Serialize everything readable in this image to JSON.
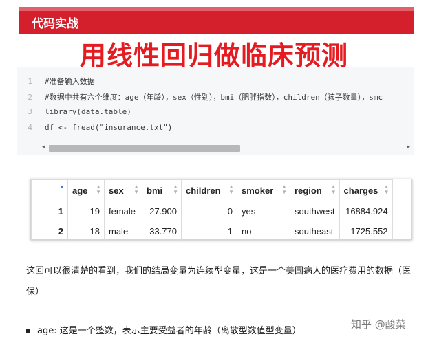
{
  "banner": {
    "title": "代码实战"
  },
  "headline": "用线性回归做临床预测",
  "code": {
    "lines": [
      {
        "num": "1",
        "text": "#准备输入数据"
      },
      {
        "num": "2",
        "text": "#数据中共有六个维度：age（年龄），sex（性别），bmi（肥胖指数），children（孩子数量），smc"
      },
      {
        "num": "3",
        "text": "library(data.table)"
      },
      {
        "num": "4",
        "text": "df <- fread(\"insurance.txt\")"
      }
    ],
    "scroll_left": "◂",
    "scroll_right": "▸"
  },
  "table": {
    "columns": [
      "",
      "age",
      "sex",
      "bmi",
      "children",
      "smoker",
      "region",
      "charges"
    ],
    "rows": [
      [
        "1",
        "19",
        "female",
        "27.900",
        "0",
        "yes",
        "southwest",
        "16884.924"
      ],
      [
        "2",
        "18",
        "male",
        "33.770",
        "1",
        "no",
        "southeast",
        "1725.552"
      ]
    ]
  },
  "paragraph": "这回可以很清楚的看到，我们的结局变量为连续型变量，这是一个美国病人的医疗费用的数据（医保）",
  "bullet": "age: 这是一个整数，表示主要受益者的年龄（离散型数值型变量）",
  "watermark": "知乎 @酸菜",
  "colors": {
    "banner": "#d4202c",
    "headline": "#e41c22",
    "sort_active": "#3b7dd8"
  }
}
